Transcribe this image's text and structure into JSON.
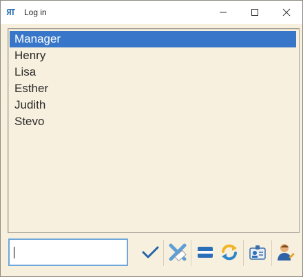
{
  "window": {
    "title": "Log in",
    "icon": "app-logo-icon",
    "icon_text": "ЯT"
  },
  "titlebar_buttons": [
    "minimize-icon",
    "maximize-icon",
    "close-icon"
  ],
  "users": {
    "items": [
      "Manager",
      "Henry",
      "Lisa",
      "Esther",
      "Judith",
      "Stevo"
    ],
    "selected_index": 0
  },
  "password": {
    "value": "",
    "placeholder": ""
  },
  "toolbar": {
    "icons": [
      "checkmark-icon",
      "clear-icon",
      "keyboard-icon",
      "refresh-icon",
      "id-card-icon",
      "user-edit-icon"
    ]
  },
  "colors": {
    "background": "#f7f0de",
    "selection": "#3776c8",
    "input_border": "#6fa6dc"
  }
}
